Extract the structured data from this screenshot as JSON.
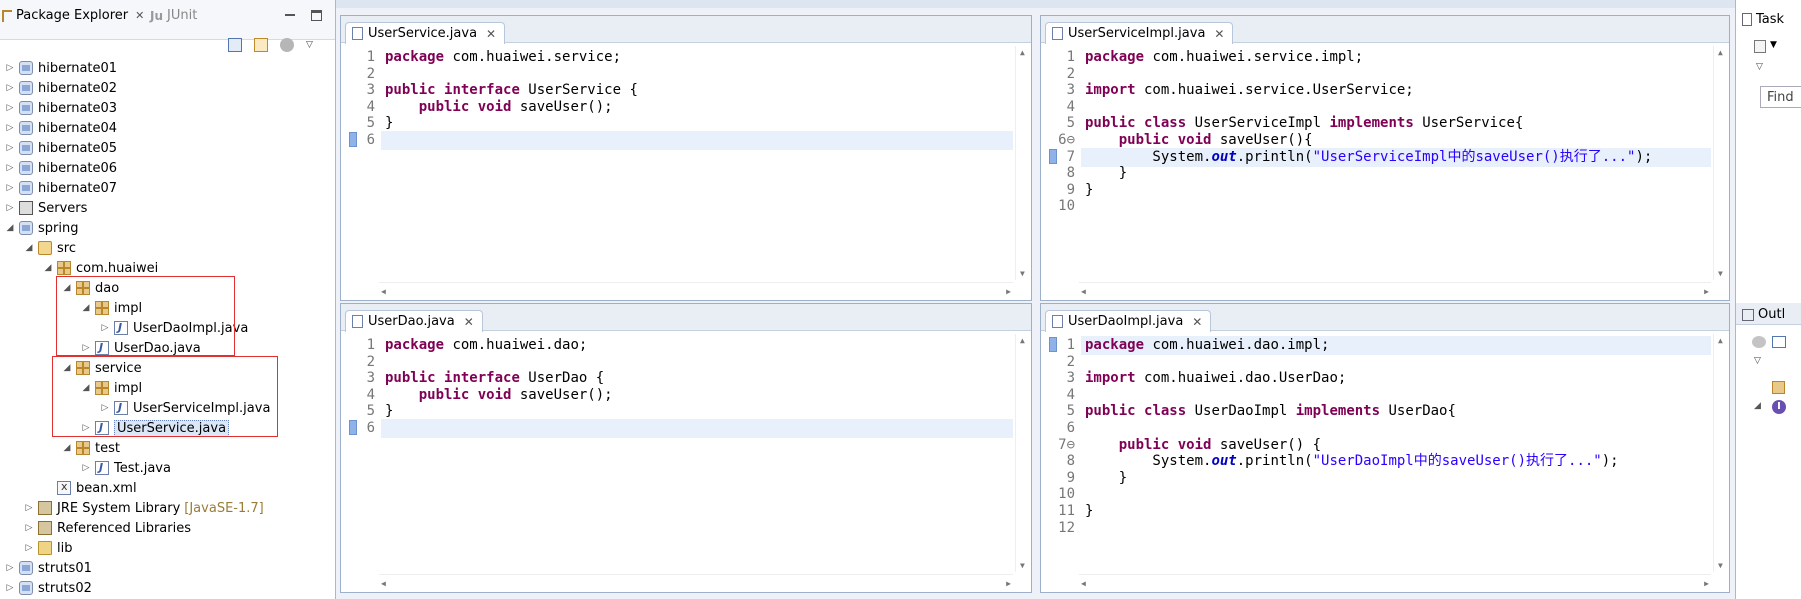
{
  "package_explorer": {
    "tab_active": "Package Explorer",
    "tab_inactive": "JUnit",
    "tree": [
      {
        "label": "hibernate01",
        "type": "proj",
        "level": 0,
        "tw": "▷"
      },
      {
        "label": "hibernate02",
        "type": "proj",
        "level": 0,
        "tw": "▷"
      },
      {
        "label": "hibernate03",
        "type": "proj",
        "level": 0,
        "tw": "▷"
      },
      {
        "label": "hibernate04",
        "type": "proj",
        "level": 0,
        "tw": "▷"
      },
      {
        "label": "hibernate05",
        "type": "proj",
        "level": 0,
        "tw": "▷"
      },
      {
        "label": "hibernate06",
        "type": "proj",
        "level": 0,
        "tw": "▷"
      },
      {
        "label": "hibernate07",
        "type": "proj",
        "level": 0,
        "tw": "▷"
      },
      {
        "label": "Servers",
        "type": "srv",
        "level": 0,
        "tw": "▷"
      },
      {
        "label": "spring",
        "type": "proj",
        "level": 0,
        "tw": "◢"
      },
      {
        "label": "src",
        "type": "src",
        "level": 1,
        "tw": "◢"
      },
      {
        "label": "com.huaiwei",
        "type": "pkg",
        "level": 2,
        "tw": "◢"
      },
      {
        "label": "dao",
        "type": "pkg",
        "level": 3,
        "tw": "◢"
      },
      {
        "label": "impl",
        "type": "pkg",
        "level": 4,
        "tw": "◢"
      },
      {
        "label": "UserDaoImpl.java",
        "type": "java",
        "level": 5,
        "tw": "▷"
      },
      {
        "label": "UserDao.java",
        "type": "java",
        "level": 4,
        "tw": "▷"
      },
      {
        "label": "service",
        "type": "pkg",
        "level": 3,
        "tw": "◢"
      },
      {
        "label": "impl",
        "type": "pkg",
        "level": 4,
        "tw": "◢"
      },
      {
        "label": "UserServiceImpl.java",
        "type": "java",
        "level": 5,
        "tw": "▷"
      },
      {
        "label": "UserService.java",
        "type": "java",
        "level": 4,
        "tw": "▷",
        "selected": true
      },
      {
        "label": "test",
        "type": "pkg",
        "level": 3,
        "tw": "◢"
      },
      {
        "label": "Test.java",
        "type": "java",
        "level": 4,
        "tw": "▷"
      },
      {
        "label": "bean.xml",
        "type": "xml",
        "level": 2,
        "tw": ""
      },
      {
        "label": "JRE System Library",
        "suffix": "[JavaSE-1.7]",
        "type": "lib",
        "level": 1,
        "tw": "▷"
      },
      {
        "label": "Referenced Libraries",
        "type": "lib",
        "level": 1,
        "tw": "▷"
      },
      {
        "label": "lib",
        "type": "folder",
        "level": 1,
        "tw": "▷"
      },
      {
        "label": "struts01",
        "type": "proj",
        "level": 0,
        "tw": "▷"
      },
      {
        "label": "struts02",
        "type": "proj",
        "level": 0,
        "tw": "▷"
      }
    ]
  },
  "editors": [
    {
      "id": "ed1",
      "tab": "UserService.java",
      "line_numbers": [
        "1",
        "2",
        "3",
        "4",
        "5",
        "6"
      ],
      "highlight_line": 6,
      "lines": [
        [
          [
            "kw",
            "package"
          ],
          [
            "t",
            " com.huaiwei.service;"
          ]
        ],
        [],
        [
          [
            "kw",
            "public"
          ],
          [
            "t",
            " "
          ],
          [
            "kw",
            "interface"
          ],
          [
            "t",
            " UserService {"
          ]
        ],
        [
          [
            "t",
            "    "
          ],
          [
            "kw",
            "public"
          ],
          [
            "t",
            " "
          ],
          [
            "kw",
            "void"
          ],
          [
            "t",
            " saveUser();"
          ]
        ],
        [
          [
            "t",
            "}"
          ]
        ],
        []
      ]
    },
    {
      "id": "ed2",
      "tab": "UserServiceImpl.java",
      "line_numbers": [
        "1",
        "2",
        "3",
        "4",
        "5",
        "6⊖",
        "7",
        "8",
        "9",
        "10"
      ],
      "highlight_line": 7,
      "lines": [
        [
          [
            "kw",
            "package"
          ],
          [
            "t",
            " com.huaiwei.service.impl;"
          ]
        ],
        [],
        [
          [
            "kw",
            "import"
          ],
          [
            "t",
            " com.huaiwei.service.UserService;"
          ]
        ],
        [],
        [
          [
            "kw",
            "public"
          ],
          [
            "t",
            " "
          ],
          [
            "kw",
            "class"
          ],
          [
            "t",
            " UserServiceImpl "
          ],
          [
            "kw",
            "implements"
          ],
          [
            "t",
            " UserService{"
          ]
        ],
        [
          [
            "t",
            "    "
          ],
          [
            "kw",
            "public"
          ],
          [
            "t",
            " "
          ],
          [
            "kw",
            "void"
          ],
          [
            "t",
            " saveUser(){"
          ]
        ],
        [
          [
            "t",
            "        System."
          ],
          [
            "fld",
            "out"
          ],
          [
            "t",
            ".println("
          ],
          [
            "str",
            "\"UserServiceImpl中的saveUser()执行了...\""
          ],
          [
            "t",
            ");"
          ]
        ],
        [
          [
            "t",
            "    }"
          ]
        ],
        [
          [
            "t",
            "}"
          ]
        ],
        []
      ]
    },
    {
      "id": "ed3",
      "tab": "UserDao.java",
      "line_numbers": [
        "1",
        "2",
        "3",
        "4",
        "5",
        "6"
      ],
      "highlight_line": 6,
      "lines": [
        [
          [
            "kw",
            "package"
          ],
          [
            "t",
            " com.huaiwei.dao;"
          ]
        ],
        [],
        [
          [
            "kw",
            "public"
          ],
          [
            "t",
            " "
          ],
          [
            "kw",
            "interface"
          ],
          [
            "t",
            " UserDao {"
          ]
        ],
        [
          [
            "t",
            "    "
          ],
          [
            "kw",
            "public"
          ],
          [
            "t",
            " "
          ],
          [
            "kw",
            "void"
          ],
          [
            "t",
            " saveUser();"
          ]
        ],
        [
          [
            "t",
            "}"
          ]
        ],
        []
      ]
    },
    {
      "id": "ed4",
      "tab": "UserDaoImpl.java",
      "line_numbers": [
        "1",
        "2",
        "3",
        "4",
        "5",
        "6",
        "7⊖",
        "8",
        "9",
        "10",
        "11",
        "12"
      ],
      "highlight_line": 1,
      "lines": [
        [
          [
            "kw",
            "package"
          ],
          [
            "t",
            " com.huaiwei.dao.impl;"
          ]
        ],
        [],
        [
          [
            "kw",
            "import"
          ],
          [
            "t",
            " com.huaiwei.dao.UserDao;"
          ]
        ],
        [],
        [
          [
            "kw",
            "public"
          ],
          [
            "t",
            " "
          ],
          [
            "kw",
            "class"
          ],
          [
            "t",
            " UserDaoImpl "
          ],
          [
            "kw",
            "implements"
          ],
          [
            "t",
            " UserDao{"
          ]
        ],
        [],
        [
          [
            "t",
            "    "
          ],
          [
            "kw",
            "public"
          ],
          [
            "t",
            " "
          ],
          [
            "kw",
            "void"
          ],
          [
            "t",
            " saveUser() {"
          ]
        ],
        [
          [
            "t",
            "        System."
          ],
          [
            "fld",
            "out"
          ],
          [
            "t",
            ".println("
          ],
          [
            "str",
            "\"UserDaoImpl中的saveUser()执行了...\""
          ],
          [
            "t",
            ");"
          ]
        ],
        [
          [
            "t",
            "    }"
          ]
        ],
        [],
        [
          [
            "t",
            "}"
          ]
        ],
        []
      ]
    }
  ],
  "right_panel": {
    "task_label": "Task",
    "find_label": "Find",
    "outline_label": "Outl"
  }
}
